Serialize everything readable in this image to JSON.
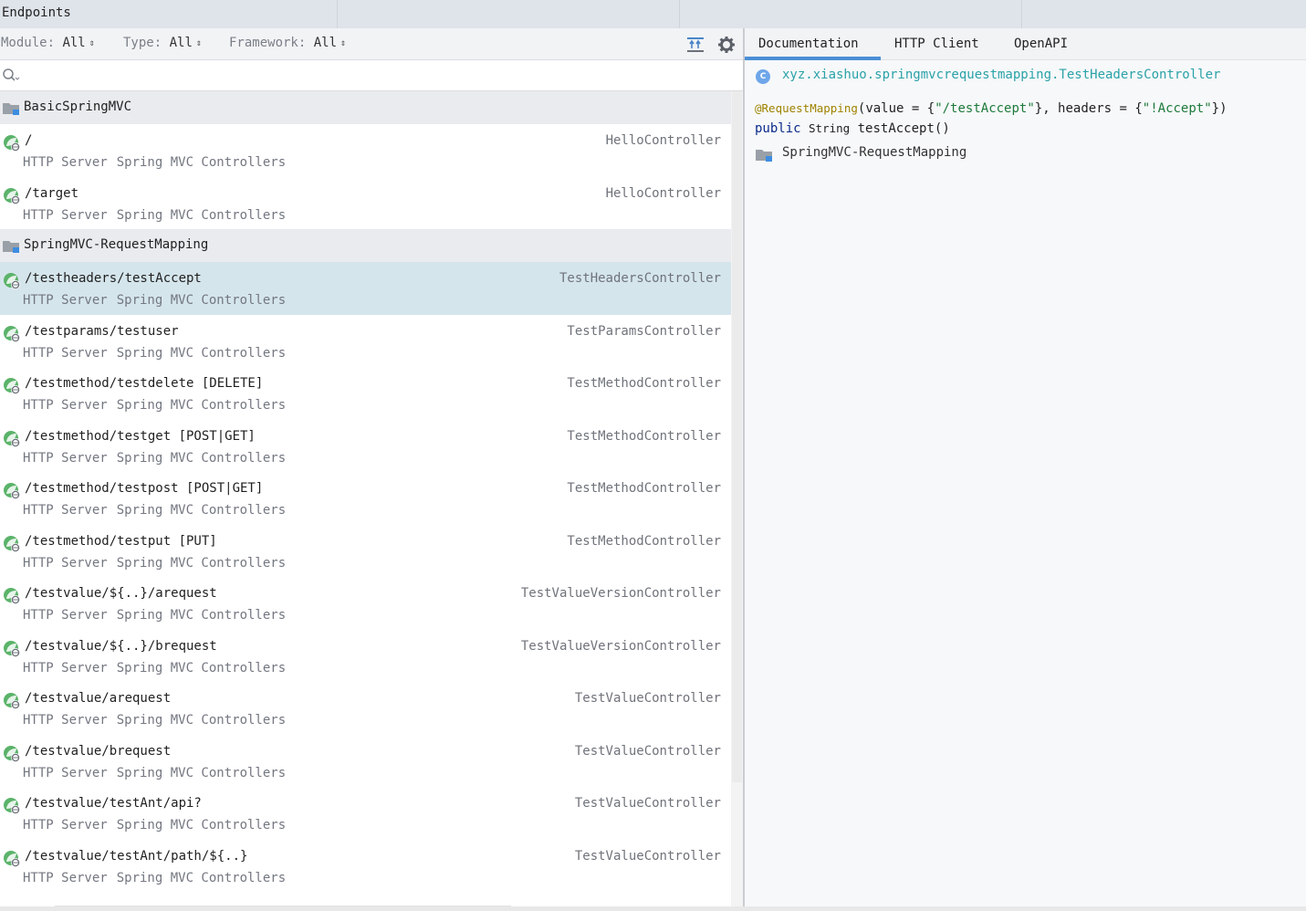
{
  "window": {
    "title": "Endpoints"
  },
  "filters": [
    {
      "label": "Module:",
      "value": "All"
    },
    {
      "label": "Type:",
      "value": "All"
    },
    {
      "label": "Framework:",
      "value": "All"
    }
  ],
  "search": {
    "placeholder": ""
  },
  "groups": [
    {
      "name": "BasicSpringMVC",
      "items": [
        {
          "path": "/",
          "controller": "HelloController",
          "type": "HTTP Server",
          "framework": "Spring MVC Controllers"
        },
        {
          "path": "/target",
          "controller": "HelloController",
          "type": "HTTP Server",
          "framework": "Spring MVC Controllers"
        }
      ]
    },
    {
      "name": "SpringMVC-RequestMapping",
      "items": [
        {
          "path": "/testheaders/testAccept",
          "controller": "TestHeadersController",
          "type": "HTTP Server",
          "framework": "Spring MVC Controllers",
          "selected": true
        },
        {
          "path": "/testparams/testuser",
          "controller": "TestParamsController",
          "type": "HTTP Server",
          "framework": "Spring MVC Controllers"
        },
        {
          "path": "/testmethod/testdelete [DELETE]",
          "controller": "TestMethodController",
          "type": "HTTP Server",
          "framework": "Spring MVC Controllers"
        },
        {
          "path": "/testmethod/testget [POST|GET]",
          "controller": "TestMethodController",
          "type": "HTTP Server",
          "framework": "Spring MVC Controllers"
        },
        {
          "path": "/testmethod/testpost [POST|GET]",
          "controller": "TestMethodController",
          "type": "HTTP Server",
          "framework": "Spring MVC Controllers"
        },
        {
          "path": "/testmethod/testput [PUT]",
          "controller": "TestMethodController",
          "type": "HTTP Server",
          "framework": "Spring MVC Controllers"
        },
        {
          "path": "/testvalue/${..}/arequest",
          "controller": "TestValueVersionController",
          "type": "HTTP Server",
          "framework": "Spring MVC Controllers"
        },
        {
          "path": "/testvalue/${..}/brequest",
          "controller": "TestValueVersionController",
          "type": "HTTP Server",
          "framework": "Spring MVC Controllers"
        },
        {
          "path": "/testvalue/arequest",
          "controller": "TestValueController",
          "type": "HTTP Server",
          "framework": "Spring MVC Controllers"
        },
        {
          "path": "/testvalue/brequest",
          "controller": "TestValueController",
          "type": "HTTP Server",
          "framework": "Spring MVC Controllers"
        },
        {
          "path": "/testvalue/testAnt/api?",
          "controller": "TestValueController",
          "type": "HTTP Server",
          "framework": "Spring MVC Controllers"
        },
        {
          "path": "/testvalue/testAnt/path/${..}",
          "controller": "TestValueController",
          "type": "HTTP Server",
          "framework": "Spring MVC Controllers"
        }
      ]
    }
  ],
  "detail": {
    "tabs": [
      "Documentation",
      "HTTP Client",
      "OpenAPI"
    ],
    "active_tab": "Documentation",
    "class_badge": "C",
    "class_name": "xyz.xiashuo.springmvcrequestmapping.TestHeadersController",
    "annotation": "@RequestMapping",
    "code_line1_a": "(value = {",
    "code_line1_str1": "\"/testAccept\"",
    "code_line1_b": "}, headers = {",
    "code_line1_str2": "\"!Accept\"",
    "code_line1_c": "})",
    "code_kw_public": "public",
    "code_type": "String",
    "code_method": "testAccept()",
    "module": "SpringMVC-RequestMapping"
  },
  "colors": {
    "accent": "#4a8fd6",
    "selection": "#d5e5ec",
    "class_link": "#2aa2a8"
  }
}
